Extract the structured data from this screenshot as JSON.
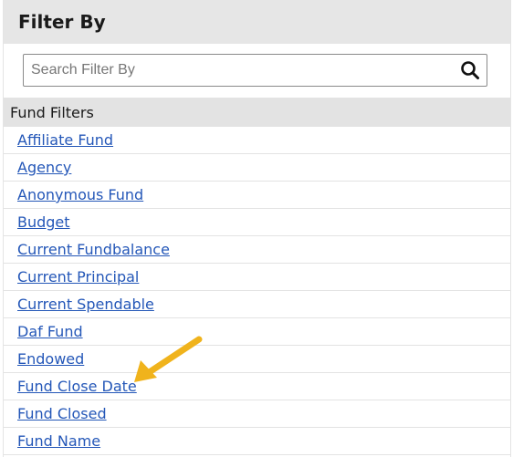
{
  "header": {
    "title": "Filter By"
  },
  "search": {
    "placeholder": "Search Filter By",
    "value": "",
    "icon": "search-icon"
  },
  "section": {
    "label": "Fund Filters"
  },
  "filters": [
    {
      "label": "Affiliate Fund"
    },
    {
      "label": "Agency"
    },
    {
      "label": "Anonymous Fund"
    },
    {
      "label": "Budget"
    },
    {
      "label": "Current Fundbalance"
    },
    {
      "label": "Current Principal"
    },
    {
      "label": "Current Spendable"
    },
    {
      "label": "Daf Fund"
    },
    {
      "label": "Endowed"
    },
    {
      "label": "Fund Close Date"
    },
    {
      "label": "Fund Closed"
    },
    {
      "label": "Fund Name"
    }
  ],
  "annotation": {
    "icon": "arrow-icon",
    "color": "#f0b31c",
    "target": "Fund Close Date"
  },
  "colors": {
    "link": "#2457b8",
    "header_bg": "#e6e6e6",
    "section_bg": "#e3e3e3"
  }
}
